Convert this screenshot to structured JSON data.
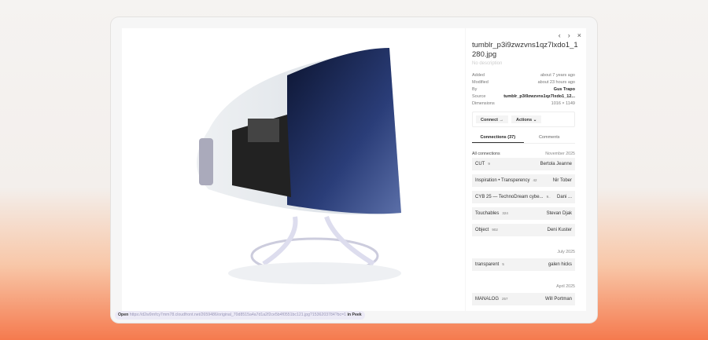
{
  "nav": {
    "prev": "‹",
    "next": "›",
    "close": "×"
  },
  "block": {
    "title": "tumblr_p3i9zwzvns1qz7lxdo1_1280.jpg",
    "description": "No description"
  },
  "meta": [
    {
      "key": "Added",
      "value": "about 7 years ago"
    },
    {
      "key": "Modified",
      "value": "about 23 hours ago"
    },
    {
      "key": "By",
      "value": "Gus Trapo"
    },
    {
      "key": "Source",
      "value": "tumblr_p3i9zwzvns1qz7lxdo1_12..."
    },
    {
      "key": "Dimensions",
      "value": "1016 × 1149"
    }
  ],
  "actions": {
    "connect": "Connect →",
    "actions": "Actions ⌄"
  },
  "tabs": {
    "connections": "Connections (37)",
    "comments": "Comments"
  },
  "connections": {
    "header": "All connections",
    "groups": [
      {
        "date": "November 2025",
        "items": [
          {
            "name": "CUT",
            "count": "9",
            "user": "Bertola Jeanne"
          },
          {
            "name": "Inspiration • Transperency",
            "count": "42",
            "user": "Nir Tober"
          },
          {
            "name": "CYB 25 — TechnoDream cybe...",
            "count": "9..",
            "user": "Dani ..."
          },
          {
            "name": "Touchables",
            "count": "324",
            "user": "Stevan Djak"
          },
          {
            "name": "Object",
            "count": "902",
            "user": "Deni Kuster"
          }
        ]
      },
      {
        "date": "July 2025",
        "items": [
          {
            "name": "transparent",
            "count": "5",
            "user": "galen hicks"
          }
        ]
      },
      {
        "date": "April 2025",
        "items": [
          {
            "name": "MANALOG",
            "count": "257",
            "user": "Will Portman"
          }
        ]
      }
    ]
  },
  "footer": {
    "open": "Open",
    "url": "https://d2w9rnfcy7mm78.cloudfront.net/2659486/original_70d8515a4a7d1a2f2ce5b4f0551bc121.jpg?1536203784?bc=1",
    "suffix": "in Peek"
  }
}
